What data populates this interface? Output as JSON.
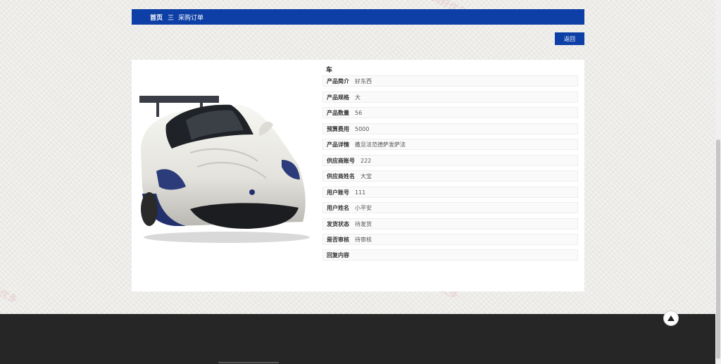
{
  "breadcrumb": {
    "home": "首页",
    "separator": "三",
    "current": "采购订单"
  },
  "actions": {
    "back_label": "返回"
  },
  "product": {
    "name": "车",
    "fields": [
      {
        "label": "产品简介",
        "value": "好东西"
      },
      {
        "label": "产品规格",
        "value": "大"
      },
      {
        "label": "产品数量",
        "value": "56"
      },
      {
        "label": "预算费用",
        "value": "5000"
      },
      {
        "label": "产品详情",
        "value": "撒旦法范德萨发萨法"
      },
      {
        "label": "供应商账号",
        "value": "222"
      },
      {
        "label": "供应商姓名",
        "value": "大宝"
      },
      {
        "label": "用户账号",
        "value": "111"
      },
      {
        "label": "用户姓名",
        "value": "小平安"
      },
      {
        "label": "发货状态",
        "value": "待发货"
      },
      {
        "label": "是否审核",
        "value": "待审核"
      },
      {
        "label": "回复内容",
        "value": ""
      }
    ]
  },
  "watermarks": [
    "源码好优多",
    "源码好优多",
    "源码好优多"
  ],
  "icons": {
    "back_to_top": "arrow-up-icon"
  },
  "colors": {
    "primary": "#0d3fa6",
    "footer": "#262626"
  }
}
